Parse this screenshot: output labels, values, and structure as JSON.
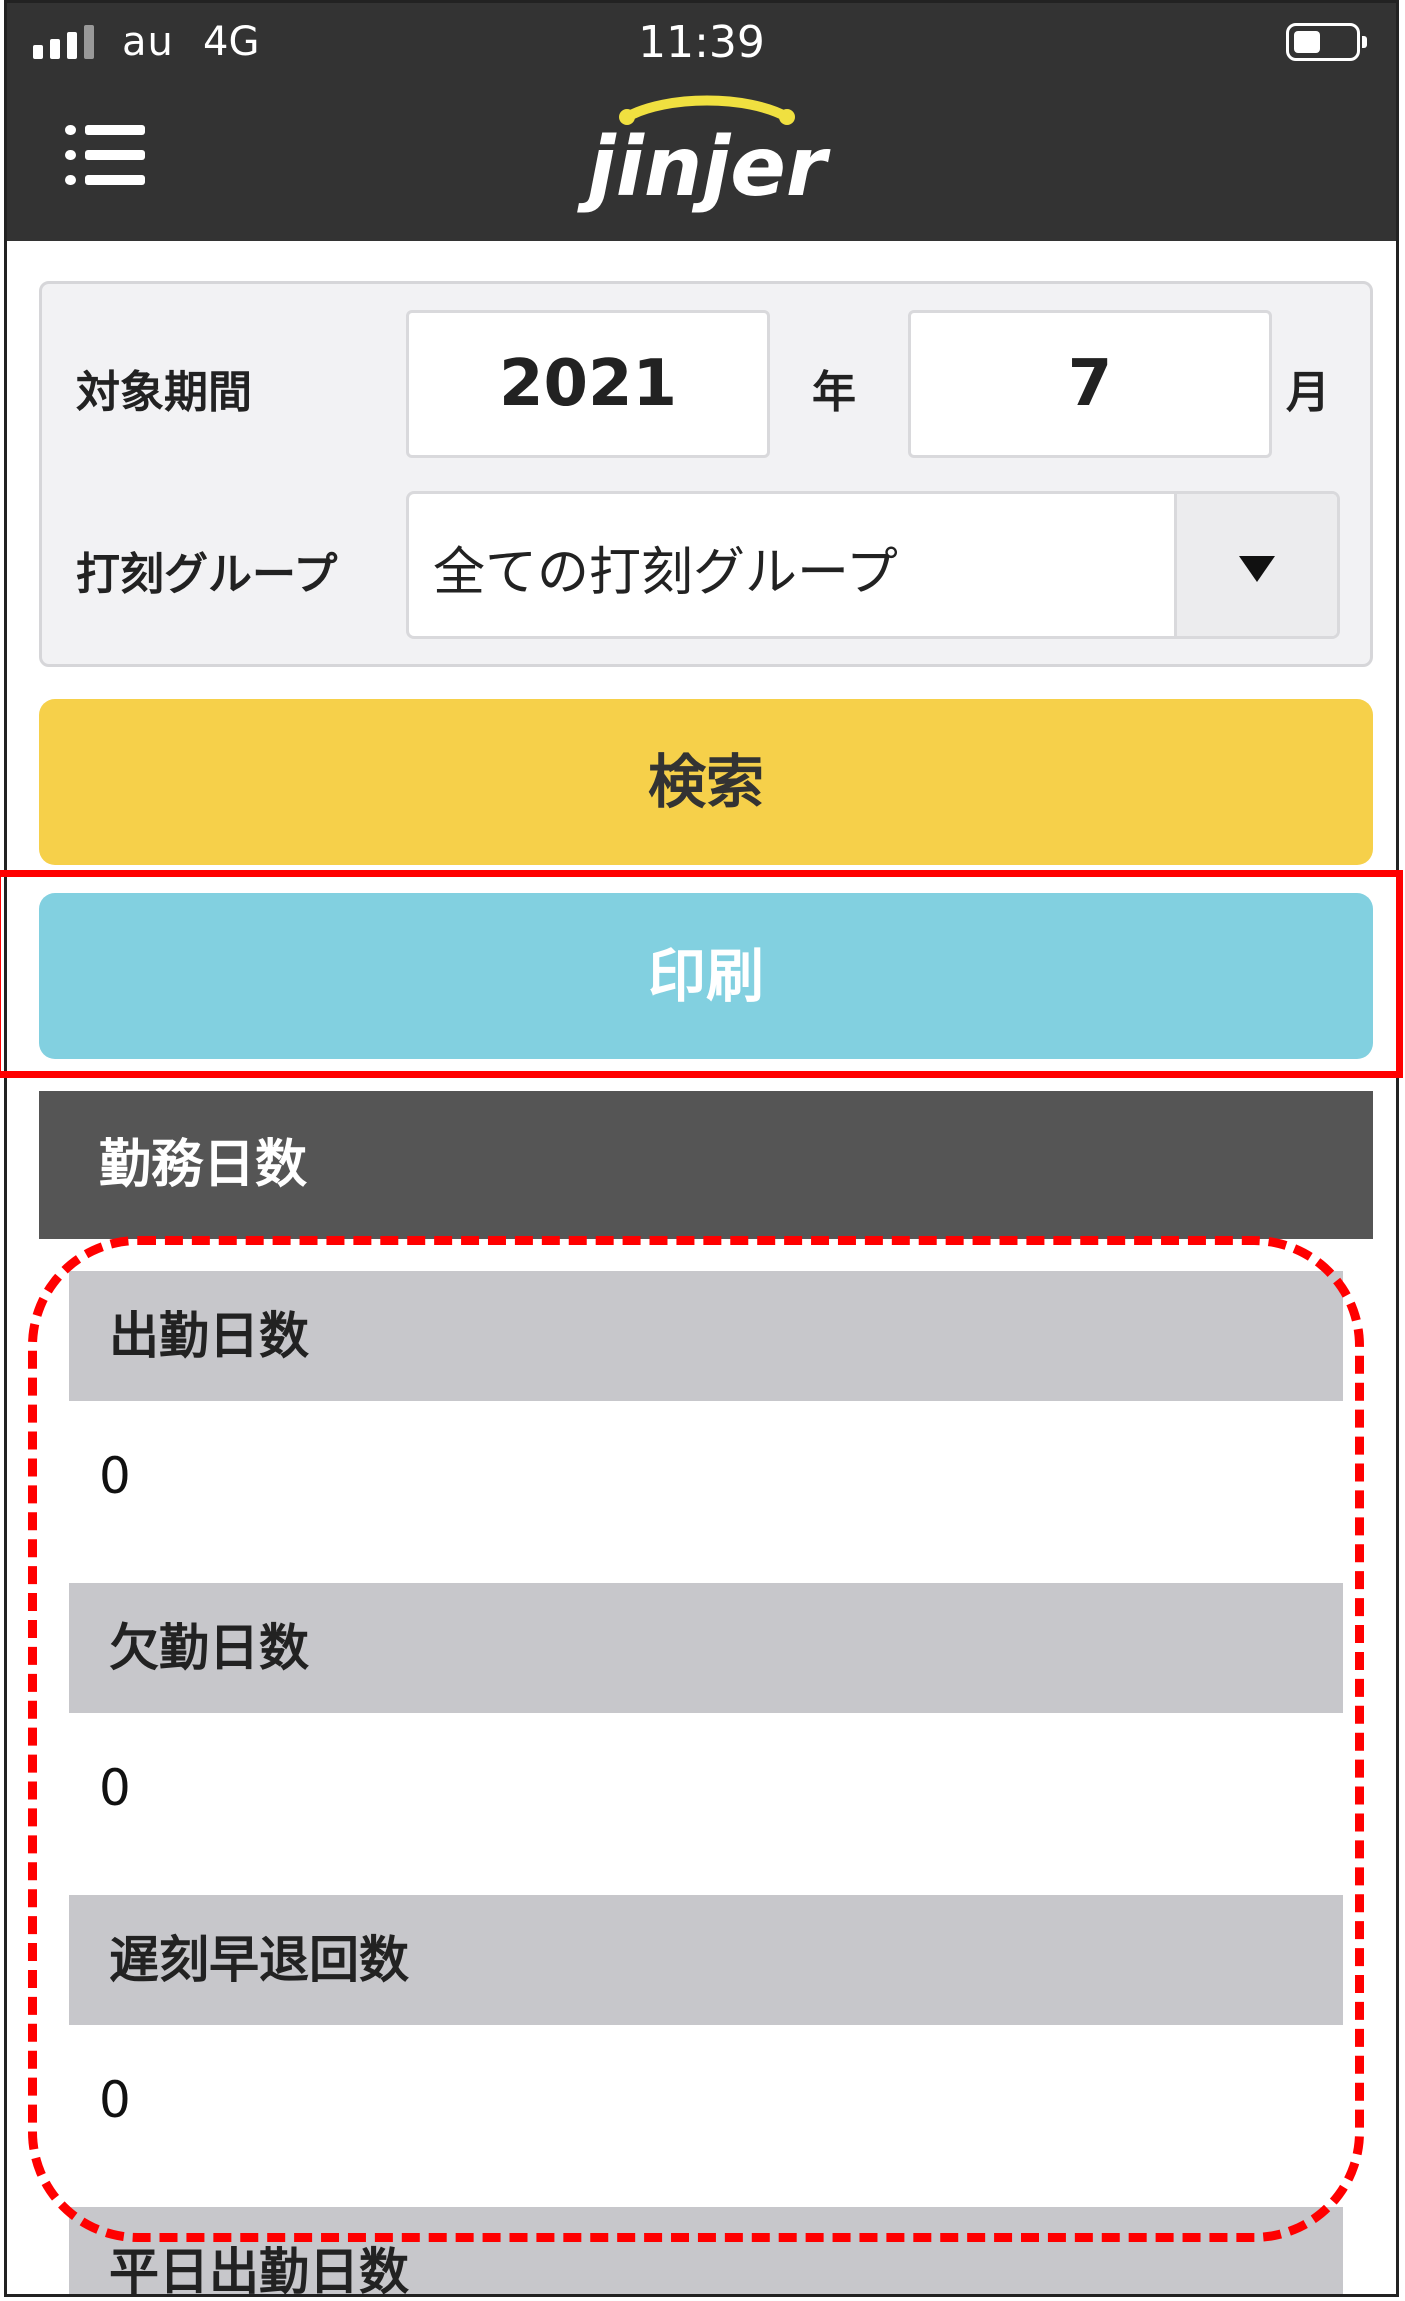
{
  "status_bar": {
    "carrier": "au",
    "network": "4G",
    "time": "11:39"
  },
  "header": {
    "logo_text": "jinjer",
    "menu_icon": "hamburger-menu-icon"
  },
  "filter": {
    "period_label": "対象期間",
    "year_value": "2021",
    "year_unit": "年",
    "month_value": "7",
    "month_unit": "月",
    "group_label": "打刻グループ",
    "group_selected": "全ての打刻グループ"
  },
  "buttons": {
    "search_label": "検索",
    "print_label": "印刷"
  },
  "section": {
    "title": "勤務日数",
    "items": [
      {
        "label": "出勤日数",
        "value": "0"
      },
      {
        "label": "欠勤日数",
        "value": "0"
      },
      {
        "label": "遅刻早退回数",
        "value": "0"
      },
      {
        "label": "平日出勤日数",
        "value": ""
      }
    ]
  },
  "colors": {
    "header_bg": "#333333",
    "logo_accent": "#f0e040",
    "search_button": "#f6d04a",
    "print_button": "#82d0e0",
    "section_bg": "#555555",
    "row_head_bg": "#c7c7cb",
    "highlight": "#ff0000"
  }
}
